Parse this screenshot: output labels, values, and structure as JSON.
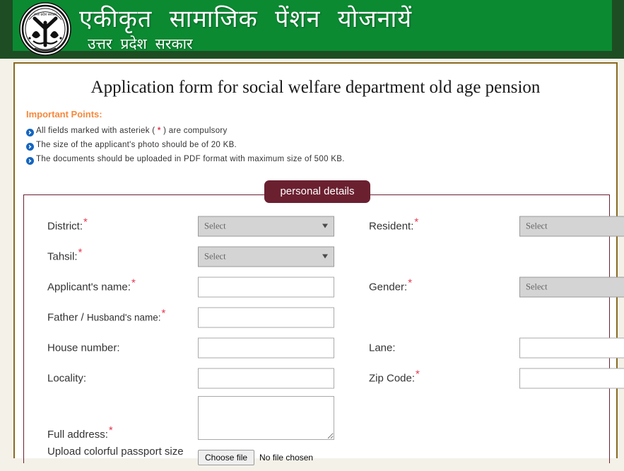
{
  "header": {
    "title_hi": "एकीकृत   सामाजिक   पेंशन   योजनायें",
    "subtitle_hi": "उत्तर प्रदेश सरकार",
    "emblem_name": "uttar-pradesh-government-emblem",
    "background_color": "#0b8a32",
    "strip_color": "#1e4d23"
  },
  "form": {
    "title": "Application form for social welfare department old age pension",
    "important_heading": "Important Points:",
    "points": [
      "All fields marked with asteriek ( * ) are compulsory",
      "The size of the applicant's photo should be of 20 KB.",
      "The documents should be uploaded in PDF format with maximum size of 500 KB."
    ],
    "point_asterisk": "*",
    "legend": "personal details",
    "accent_color": "#6b2030",
    "required_color": "#e8354e",
    "important_color": "#f5883c",
    "panel_border_color": "#8a6a21"
  },
  "fields": {
    "district": {
      "label": "District:",
      "required": true,
      "type": "select",
      "value": "Select"
    },
    "resident": {
      "label": "Resident:",
      "required": true,
      "type": "select",
      "value": "Select"
    },
    "tahsil": {
      "label": "Tahsil:",
      "required": true,
      "type": "select",
      "value": "Select"
    },
    "applicant_name": {
      "label": "Applicant's name:",
      "required": true,
      "type": "text",
      "value": ""
    },
    "gender": {
      "label": "Gender:",
      "required": true,
      "type": "select",
      "value": "Select"
    },
    "father_husband_name": {
      "label_big": "Father /",
      "label_small": "Husband's name:",
      "required": true,
      "type": "text",
      "value": ""
    },
    "house_number": {
      "label": "House number:",
      "required": false,
      "type": "text",
      "value": ""
    },
    "lane": {
      "label": "Lane:",
      "required": false,
      "type": "text",
      "value": ""
    },
    "locality": {
      "label": "Locality:",
      "required": false,
      "type": "text",
      "value": ""
    },
    "zip_code": {
      "label": "Zip Code:",
      "required": true,
      "type": "text",
      "value": ""
    },
    "full_address": {
      "label": "Full address:",
      "required": true,
      "type": "textarea",
      "value": ""
    },
    "photo_upload": {
      "label": "Upload colorful passport size",
      "button": "Choose file",
      "status": "No file chosen"
    }
  }
}
